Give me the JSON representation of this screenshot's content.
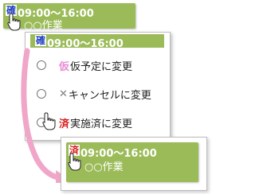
{
  "top_card": {
    "badge": "確",
    "time": "09:00～16:00",
    "task": "○○作業"
  },
  "menu": {
    "header": {
      "badge": "確",
      "time": "09:00～16:00"
    },
    "items": [
      {
        "glyph": "仮",
        "label": "仮予定に変更"
      },
      {
        "glyph": "✕",
        "label": "キャンセルに変更"
      },
      {
        "glyph": "済",
        "label": "実施済に変更"
      }
    ]
  },
  "result_card": {
    "badge": "済",
    "time": "09:00～16:00",
    "task": "○○作業"
  },
  "colors": {
    "card_green": "#9bbb59",
    "confirmed_badge": "#1f3fbf",
    "tentative_badge": "#e88bd4",
    "cancel_mark": "#7f7f7f",
    "done_badge": "#d62020",
    "arrow_pink": "#f0a6c8"
  },
  "icons": [
    "hand-pointer-icon",
    "curved-arrow-icon",
    "radio-icon"
  ]
}
